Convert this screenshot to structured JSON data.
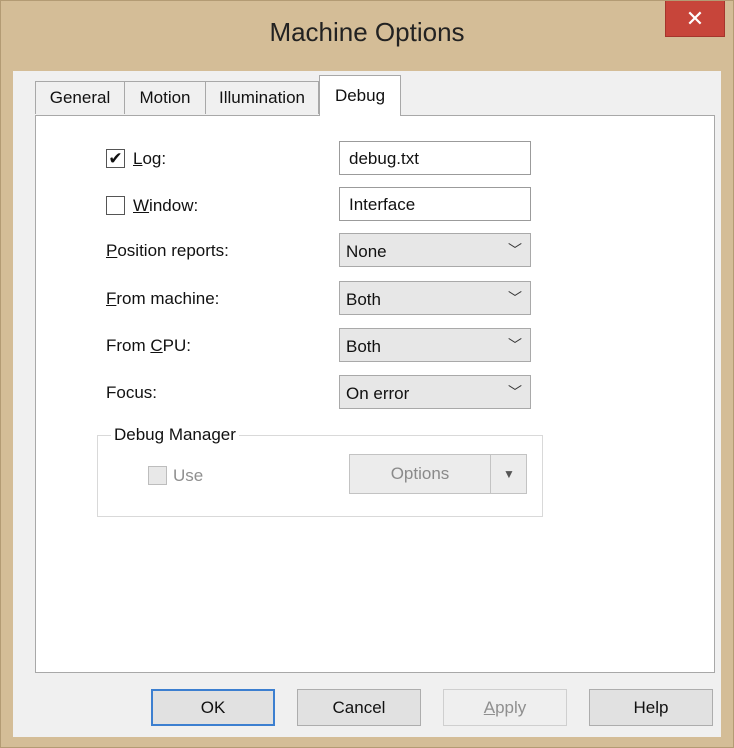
{
  "window": {
    "title": "Machine Options",
    "close_glyph": "✕"
  },
  "tabs": [
    {
      "label": "General"
    },
    {
      "label": "Motion"
    },
    {
      "label": "Illumination"
    },
    {
      "label": "Debug"
    }
  ],
  "debug": {
    "log": {
      "checked": true,
      "label_underlined": "L",
      "label_rest": "og:",
      "value": "debug.txt"
    },
    "window": {
      "checked": false,
      "label_underlined": "W",
      "label_rest": "indow:",
      "value": "Interface"
    },
    "position_reports": {
      "label_underlined": "P",
      "label_rest": "osition reports:",
      "value": "None"
    },
    "from_machine": {
      "label_underlined": "F",
      "label_rest": "rom machine:",
      "value": "Both"
    },
    "from_cpu": {
      "label_pre": "From ",
      "label_underlined": "C",
      "label_rest": "PU:",
      "value": "Both"
    },
    "focus": {
      "label": "Focus:",
      "value": "On error"
    },
    "check_glyph": "✔",
    "combo_arrow": "﹀"
  },
  "debug_manager": {
    "title": "Debug Manager",
    "use_label": "Use",
    "options_label": "Options",
    "dropdown_glyph": "▼"
  },
  "buttons": {
    "ok": "OK",
    "cancel": "Cancel",
    "apply_underlined": "A",
    "apply_rest": "pply",
    "help": "Help"
  }
}
